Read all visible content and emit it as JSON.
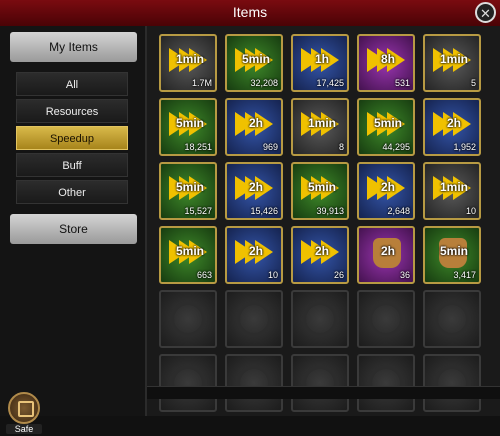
{
  "header": {
    "title": "Items",
    "close_icon": "close-icon"
  },
  "sidebar": {
    "top_label": "My Items",
    "filters": [
      {
        "label": "All"
      },
      {
        "label": "Resources"
      },
      {
        "label": "Speedup",
        "active": true
      },
      {
        "label": "Buff"
      },
      {
        "label": "Other"
      }
    ],
    "store_label": "Store"
  },
  "safe": {
    "label": "Safe",
    "icon": "safe-icon"
  },
  "grid": {
    "rows": [
      [
        {
          "bg": "dark",
          "time": "1min",
          "qty": "1.7M"
        },
        {
          "bg": "green",
          "time": "5min",
          "qty": "32,208"
        },
        {
          "bg": "blue",
          "time": "1h",
          "qty": "17,425"
        },
        {
          "bg": "purple",
          "time": "8h",
          "qty": "531"
        },
        {
          "bg": "dark",
          "time": "1min",
          "qty": "5"
        }
      ],
      [
        {
          "bg": "green",
          "time": "5min",
          "qty": "18,251"
        },
        {
          "bg": "blue",
          "time": "2h",
          "qty": "969"
        },
        {
          "bg": "dark",
          "time": "1min",
          "qty": "8"
        },
        {
          "bg": "green",
          "time": "5min",
          "qty": "44,295"
        },
        {
          "bg": "blue",
          "time": "2h",
          "qty": "1,952"
        }
      ],
      [
        {
          "bg": "green",
          "time": "5min",
          "qty": "15,527"
        },
        {
          "bg": "blue",
          "time": "2h",
          "qty": "15,426"
        },
        {
          "bg": "green",
          "time": "5min",
          "qty": "39,913"
        },
        {
          "bg": "blue",
          "time": "2h",
          "qty": "2,648"
        },
        {
          "bg": "dark",
          "time": "1min",
          "qty": "10"
        }
      ],
      [
        {
          "bg": "green",
          "time": "5min",
          "qty": "663"
        },
        {
          "bg": "blue",
          "time": "2h",
          "qty": "10"
        },
        {
          "bg": "blue",
          "time": "2h",
          "qty": "26"
        },
        {
          "bg": "purple",
          "time": "2h",
          "qty": "36",
          "bag": true
        },
        {
          "bg": "green",
          "time": "5min",
          "qty": "3,417",
          "bag": true
        }
      ]
    ],
    "empty_rows": 2
  },
  "colors": {
    "accent": "#b79a43",
    "titlebar": "#7a0b10",
    "active_filter": "#d8b94a"
  }
}
